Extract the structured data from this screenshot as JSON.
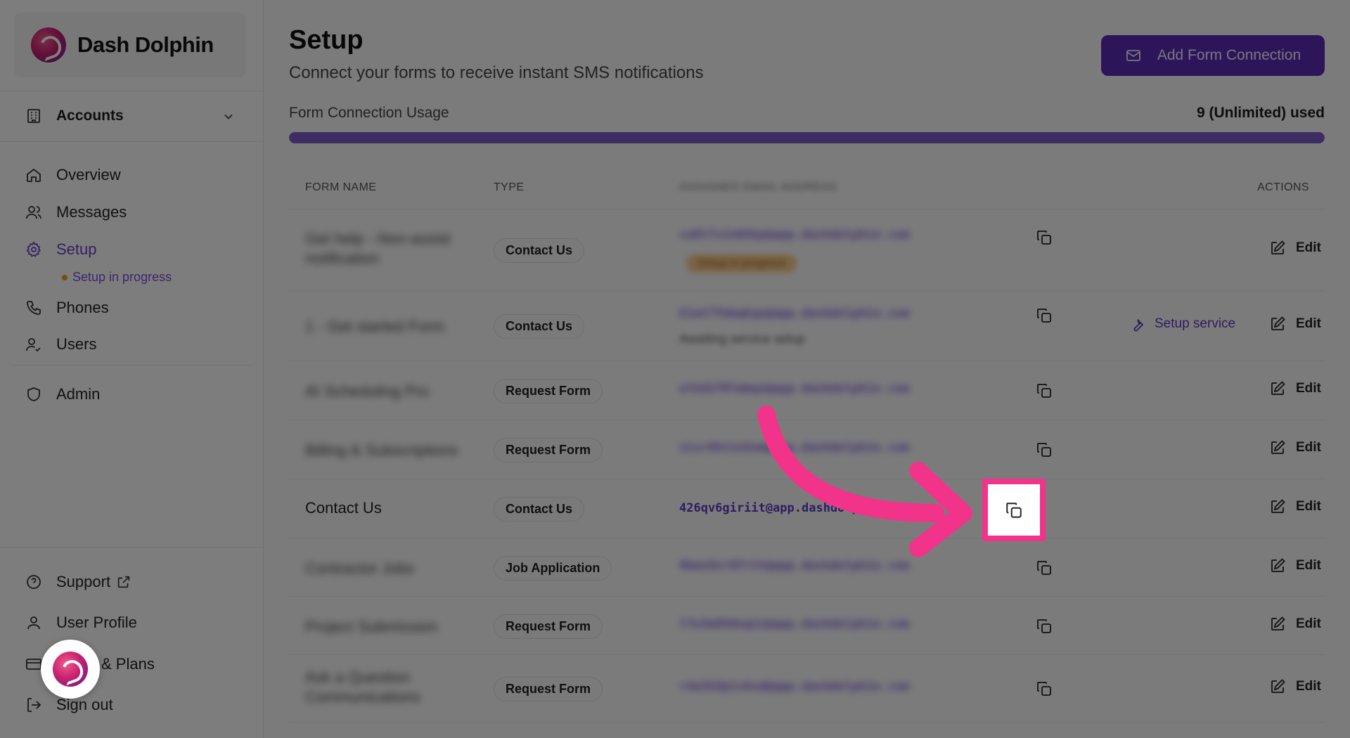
{
  "brand": {
    "name": "Dash Dolphin"
  },
  "sidebar": {
    "accounts_label": "Accounts",
    "nav": [
      {
        "label": "Overview",
        "icon": "home-icon"
      },
      {
        "label": "Messages",
        "icon": "users-icon"
      },
      {
        "label": "Setup",
        "icon": "gear-icon"
      },
      {
        "label": "Phones",
        "icon": "phone-icon"
      },
      {
        "label": "Users",
        "icon": "user-check-icon"
      }
    ],
    "setup_status": "Setup in progress",
    "admin_label": "Admin",
    "bottom": [
      {
        "label": "Support",
        "icon": "help-circle-icon"
      },
      {
        "label": "User Profile",
        "icon": "user-icon"
      },
      {
        "label": "& Plans",
        "icon": "credit-card-icon"
      },
      {
        "label": "Sign out",
        "icon": "sign-out-icon"
      }
    ]
  },
  "header": {
    "title": "Setup",
    "subtitle": "Connect your forms to receive instant SMS notifications",
    "add_button_label": "Add Form Connection"
  },
  "usage": {
    "label": "Form Connection Usage",
    "value_text": "9 (Unlimited) used",
    "fill_fraction": 1.0
  },
  "table": {
    "columns": {
      "name": "FORM NAME",
      "type": "TYPE",
      "email": "ASSIGNED EMAIL ADDRESS",
      "actions": "ACTIONS"
    },
    "rows": [
      {
        "name": "Get help - Non-assist notification",
        "type": "Contact Us",
        "email": "ca8t7s1nbhkp@app.dashdolphin.com",
        "badge": "Setup in progress",
        "blurred": true
      },
      {
        "name": "1 - Get started Form",
        "type": "Contact Us",
        "email": "k1at7fmbqkqu@app.dashdolphin.com",
        "email_sub": "Awaiting service setup",
        "service_label": "Setup service",
        "blurred": true
      },
      {
        "name": "AI Scheduling Pro",
        "type": "Request Form",
        "email": "wlkd1f0lmbqx@app.dashdolphin.com",
        "blurred": true
      },
      {
        "name": "Billing & Subscriptions",
        "type": "Request Form",
        "email": "s1xr6ht1n5nm@app.dashdolphin.com",
        "blurred": true
      },
      {
        "name": "Contact Us",
        "type": "Contact Us",
        "email": "426qv6giriit@app.dashdolp",
        "blurred": false
      },
      {
        "name": "Contractor Jobs",
        "type": "Job Application",
        "email": "9bms0zr0fr1t@app.dashdolphin.com",
        "blurred": true
      },
      {
        "name": "Project Submission",
        "type": "Request Form",
        "email": "l7w3m8h0uq2z@app.dashdolphin.com",
        "blurred": true
      },
      {
        "name": "Ask a Question Communications",
        "type": "Request Form",
        "email": "r4e2k9p1v6sd@app.dashdolphin.com",
        "blurred": true
      }
    ],
    "edit_label": "Edit"
  }
}
